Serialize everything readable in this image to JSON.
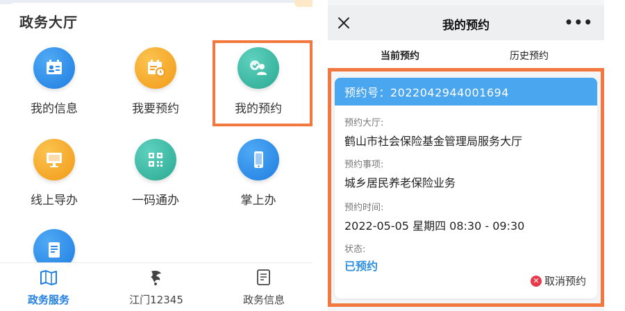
{
  "left": {
    "section_title": "政务大厅",
    "grid": [
      {
        "label": "我的信息",
        "icon": "id-card-icon",
        "color": "#2a8ae8"
      },
      {
        "label": "我要预约",
        "icon": "calendar-clock-icon",
        "color": "#f5a623"
      },
      {
        "label": "我的预约",
        "icon": "user-chat-icon",
        "color": "#3bb7a3"
      },
      {
        "label": "线上导办",
        "icon": "monitor-icon",
        "color": "#f5a623"
      },
      {
        "label": "一码通办",
        "icon": "qr-code-icon",
        "color": "#3bb7a3"
      },
      {
        "label": "掌上办",
        "icon": "mobile-icon",
        "color": "#2a8ae8"
      },
      {
        "label": "",
        "icon": "document-icon",
        "color": "#2a8ae8"
      }
    ],
    "tabs": [
      {
        "label": "政务服务",
        "icon": "map-icon",
        "active": true
      },
      {
        "label": "江门12345",
        "icon": "logo-icon",
        "active": false
      },
      {
        "label": "政务信息",
        "icon": "doc-list-icon",
        "active": false
      }
    ],
    "highlight_color": "#f37840"
  },
  "right": {
    "nav_title": "我的预约",
    "more_label": "•••",
    "tabs": {
      "current": "当前预约",
      "history": "历史预约"
    },
    "card": {
      "header": "预约号：2022042944001694",
      "hall_label": "预约大厅:",
      "hall_value": "鹤山市社会保险基金管理局服务大厅",
      "item_label": "预约事项:",
      "item_value": "城乡居民养老保险业务",
      "time_label": "预约时间:",
      "time_value": "2022-05-05  星期四  08:30 - 09:30",
      "status_label": "状态:",
      "status_value": "已预约",
      "cancel_label": "取消预约",
      "cancel_icon_glyph": "✕"
    },
    "accent_color": "#4aa6ee"
  }
}
